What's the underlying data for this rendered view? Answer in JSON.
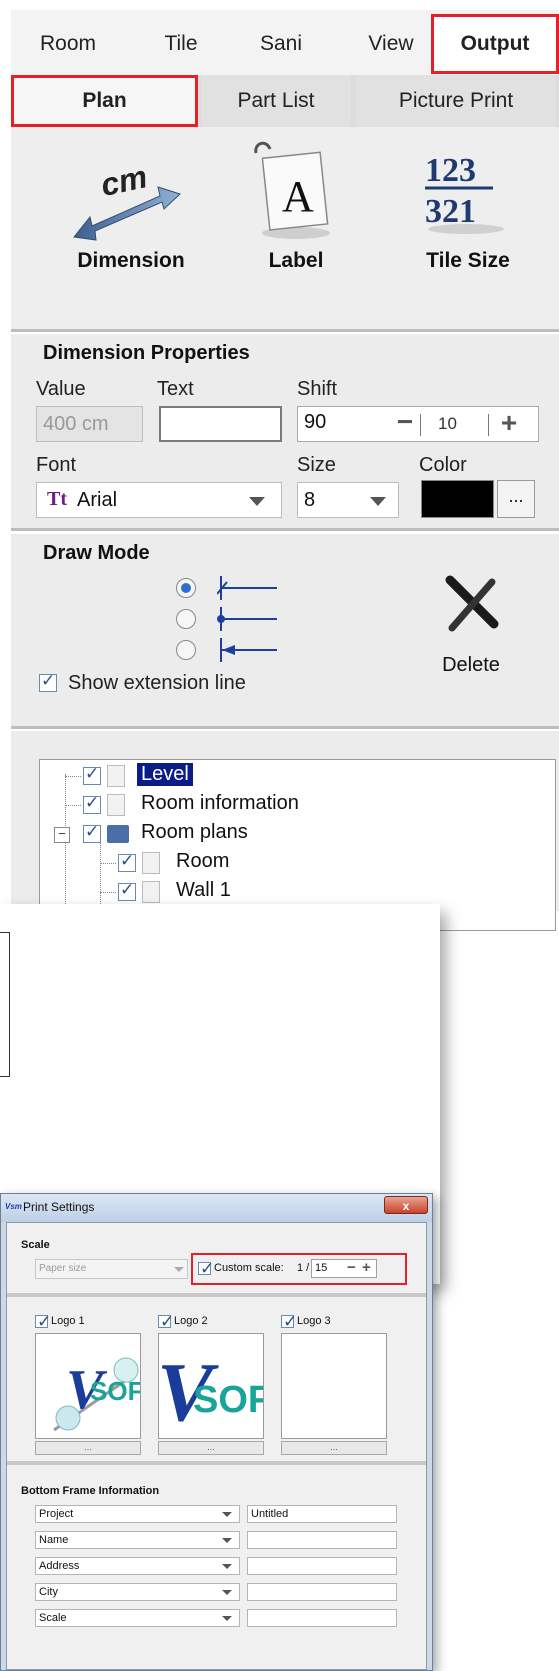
{
  "main_tabs": [
    "Room",
    "Tile",
    "Sani",
    "View",
    "Output"
  ],
  "sub_tabs": [
    "Plan",
    "Part List",
    "Picture Print"
  ],
  "tools": [
    {
      "label": "Dimension",
      "icon": "dimension-icon"
    },
    {
      "label": "Label",
      "icon": "label-icon"
    },
    {
      "label": "Tile Size",
      "icon": "tile-size-icon"
    }
  ],
  "tool_glyphs": {
    "cm": "cm",
    "label_letter": "A",
    "tile_top": "123",
    "tile_bottom": "321"
  },
  "dim_props": {
    "title": "Dimension Properties",
    "value_label": "Value",
    "value": "400 cm",
    "text_label": "Text",
    "text_value": "",
    "shift_label": "Shift",
    "shift_value": "90",
    "step_value": "10",
    "minus": "−",
    "plus": "+",
    "font_label": "Font",
    "font_value": "Arial",
    "font_icon_text": "Tt",
    "size_label": "Size",
    "size_value": "8",
    "color_label": "Color",
    "color_value": "#000000",
    "color_more": "..."
  },
  "draw_mode": {
    "title": "Draw Mode",
    "selected_index": 0,
    "show_extension_label": "Show extension line",
    "show_extension_checked": true,
    "delete_label": "Delete"
  },
  "tree": {
    "items": [
      {
        "label": "Level",
        "selected": true
      },
      {
        "label": "Room information"
      },
      {
        "label": "Room plans"
      },
      {
        "label": "Room"
      },
      {
        "label": "Wall 1"
      }
    ],
    "expander": "−"
  },
  "print_settings": {
    "title": "Print Settings",
    "close": "x",
    "app_icon_text": "Vsm",
    "scale_group": "Scale",
    "paper_size": "Paper size",
    "custom_scale_label": "Custom scale:",
    "custom_scale_checked": true,
    "scale_prefix": "1 /",
    "scale_value": "15",
    "minus": "−",
    "plus": "+",
    "logos": [
      {
        "label": "Logo 1",
        "checked": true,
        "button": "...",
        "text": "SOFT"
      },
      {
        "label": "Logo 2",
        "checked": true,
        "button": "...",
        "text": "SOFT"
      },
      {
        "label": "Logo 3",
        "checked": true,
        "button": "...",
        "text": ""
      }
    ],
    "bottom_frame_title": "Bottom Frame Information",
    "frame_rows": [
      {
        "field": "Project",
        "value": "Untitled"
      },
      {
        "field": "Name",
        "value": ""
      },
      {
        "field": "Address",
        "value": ""
      },
      {
        "field": "City",
        "value": ""
      },
      {
        "field": "Scale",
        "value": ""
      }
    ]
  },
  "colors": {
    "highlight": "#e5202a",
    "selection": "#0b1c8a",
    "accent_blue": "#1f3f9f",
    "logo_green": "#19a39a"
  }
}
